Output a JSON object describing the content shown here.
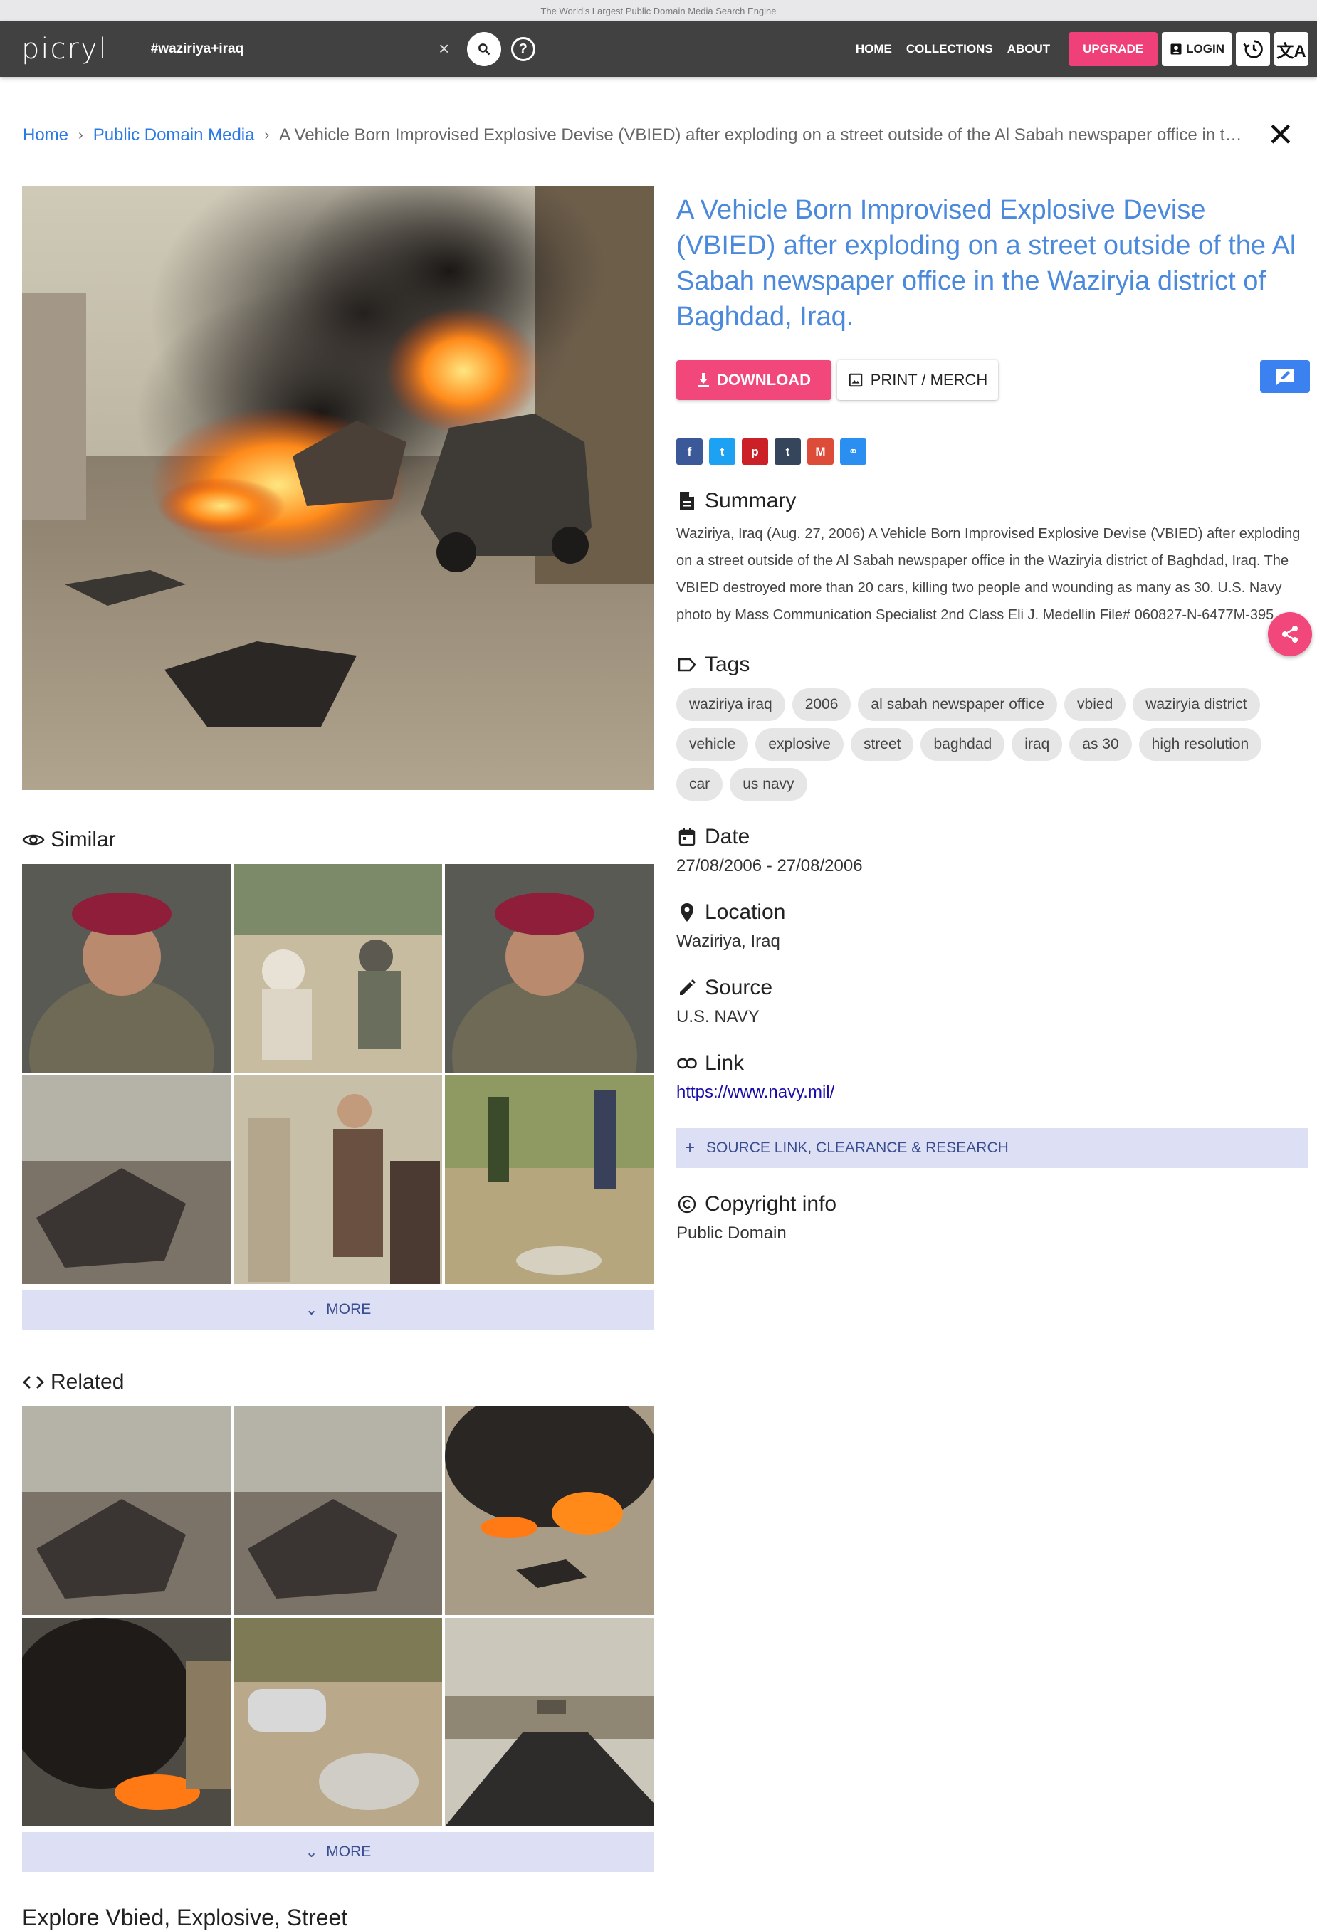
{
  "tagline": "The World's Largest Public Domain Media Search Engine",
  "header": {
    "logo": "picryl",
    "search_value": "#waziriya+iraq",
    "nav": [
      "HOME",
      "COLLECTIONS",
      "ABOUT"
    ],
    "upgrade": "UPGRADE",
    "login": "LOGIN"
  },
  "breadcrumb": {
    "home": "Home",
    "section": "Public Domain Media",
    "current": "A Vehicle Born Improvised Explosive Devise (VBIED) after exploding on a street outside of the Al Sabah newspaper office in the Waziryia district of Baghdad, Iraq."
  },
  "item": {
    "title": "A Vehicle Born Improvised Explosive Devise (VBIED) after exploding on a street outside of the Al Sabah newspaper office in the Waziryia district of Baghdad, Iraq.",
    "download": "DOWNLOAD",
    "print": "PRINT / MERCH"
  },
  "share_icons": [
    {
      "name": "facebook-icon",
      "glyph": "f",
      "color": "#3b5998"
    },
    {
      "name": "twitter-icon",
      "glyph": "t",
      "color": "#1da1f2"
    },
    {
      "name": "pinterest-icon",
      "glyph": "p",
      "color": "#cb2027"
    },
    {
      "name": "tumblr-icon",
      "glyph": "t",
      "color": "#35465c"
    },
    {
      "name": "gmail-icon",
      "glyph": "M",
      "color": "#dd4b39"
    },
    {
      "name": "link-icon",
      "glyph": "⚭",
      "color": "#2a8ff0"
    }
  ],
  "summary": {
    "heading": "Summary",
    "text": "Waziriya, Iraq (Aug. 27, 2006) A Vehicle Born Improvised Explosive Devise (VBIED) after exploding on a street outside of the Al Sabah newspaper office in the Waziryia district of Baghdad, Iraq. The VBIED destroyed more than 20 cars, killing two people and wounding as many as 30. U.S. Navy photo by Mass Communication Specialist 2nd Class Eli J. Medellin File# 060827-N-6477M-395"
  },
  "tags": {
    "heading": "Tags",
    "items": [
      "waziriya iraq",
      "2006",
      "al sabah newspaper office",
      "vbied",
      "waziryia district",
      "vehicle",
      "explosive",
      "street",
      "baghdad",
      "iraq",
      "as 30",
      "high resolution",
      "car",
      "us navy"
    ]
  },
  "date": {
    "heading": "Date",
    "value": "27/08/2006 - 27/08/2006"
  },
  "location": {
    "heading": "Location",
    "value": "Waziriya, Iraq"
  },
  "source": {
    "heading": "Source",
    "value": "U.S. NAVY"
  },
  "link": {
    "heading": "Link",
    "value": "https://www.navy.mil/"
  },
  "source_link_bar": "SOURCE LINK, CLEARANCE & RESEARCH",
  "copyright": {
    "heading": "Copyright info",
    "value": "Public Domain"
  },
  "similar": {
    "heading": "Similar",
    "more": "MORE"
  },
  "related": {
    "heading": "Related",
    "more": "MORE"
  },
  "explore": "Explore Vbied, Explosive, Street"
}
